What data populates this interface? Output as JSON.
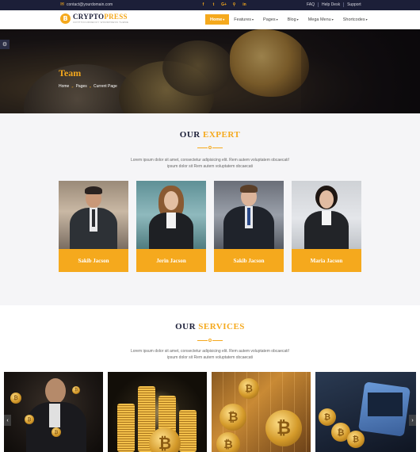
{
  "topbar": {
    "email": "contact@yourdomain.com",
    "social_icons": [
      {
        "name": "facebook-icon",
        "glyph": "f"
      },
      {
        "name": "twitter-icon",
        "glyph": "t"
      },
      {
        "name": "google-plus-icon",
        "glyph": "G+"
      },
      {
        "name": "rss-icon",
        "glyph": "⚲"
      },
      {
        "name": "linkedin-icon",
        "glyph": "in"
      }
    ],
    "links": [
      "FAQ",
      "Help Desk",
      "Support"
    ]
  },
  "navbar": {
    "logo_badge": "B",
    "logo_word1": "CRYPTO",
    "logo_word2": "PRESS",
    "logo_tagline": "CRYPTOCURRENCY WORDPRESS THEME",
    "menu": [
      "Home",
      "Features",
      "Pages",
      "Blog",
      "Mega Menu",
      "Shortcodes"
    ],
    "active_menu": "Home"
  },
  "hero": {
    "title": "Team",
    "breadcrumb": [
      "Home",
      "Pages",
      "Current Page"
    ]
  },
  "expert": {
    "title_word1": "OUR",
    "title_word2": "EXPERT",
    "desc_line1": "Lorem ipsum dolor sit amet, consectetur adipisicing elit. Rem autem voluptatem obcaecati!",
    "desc_line2": "ipsum dolor sit Rem autem voluptatem obcaecati",
    "members": [
      "Sakib Jacson",
      "Jerin Jacson",
      "Sakib Jacson",
      "Maria Jacson"
    ]
  },
  "services": {
    "title_word1": "OUR",
    "title_word2": "SERVICES",
    "desc_line1": "Lorem ipsum dolor sit amet, consectetur adipisicing elit. Rem autem voluptatem obcaecati!",
    "desc_line2": "ipsum dolor sit Rem autem voluptatem obcaecati"
  },
  "colors": {
    "accent": "#f5a91d",
    "dark": "#1c1f38"
  }
}
